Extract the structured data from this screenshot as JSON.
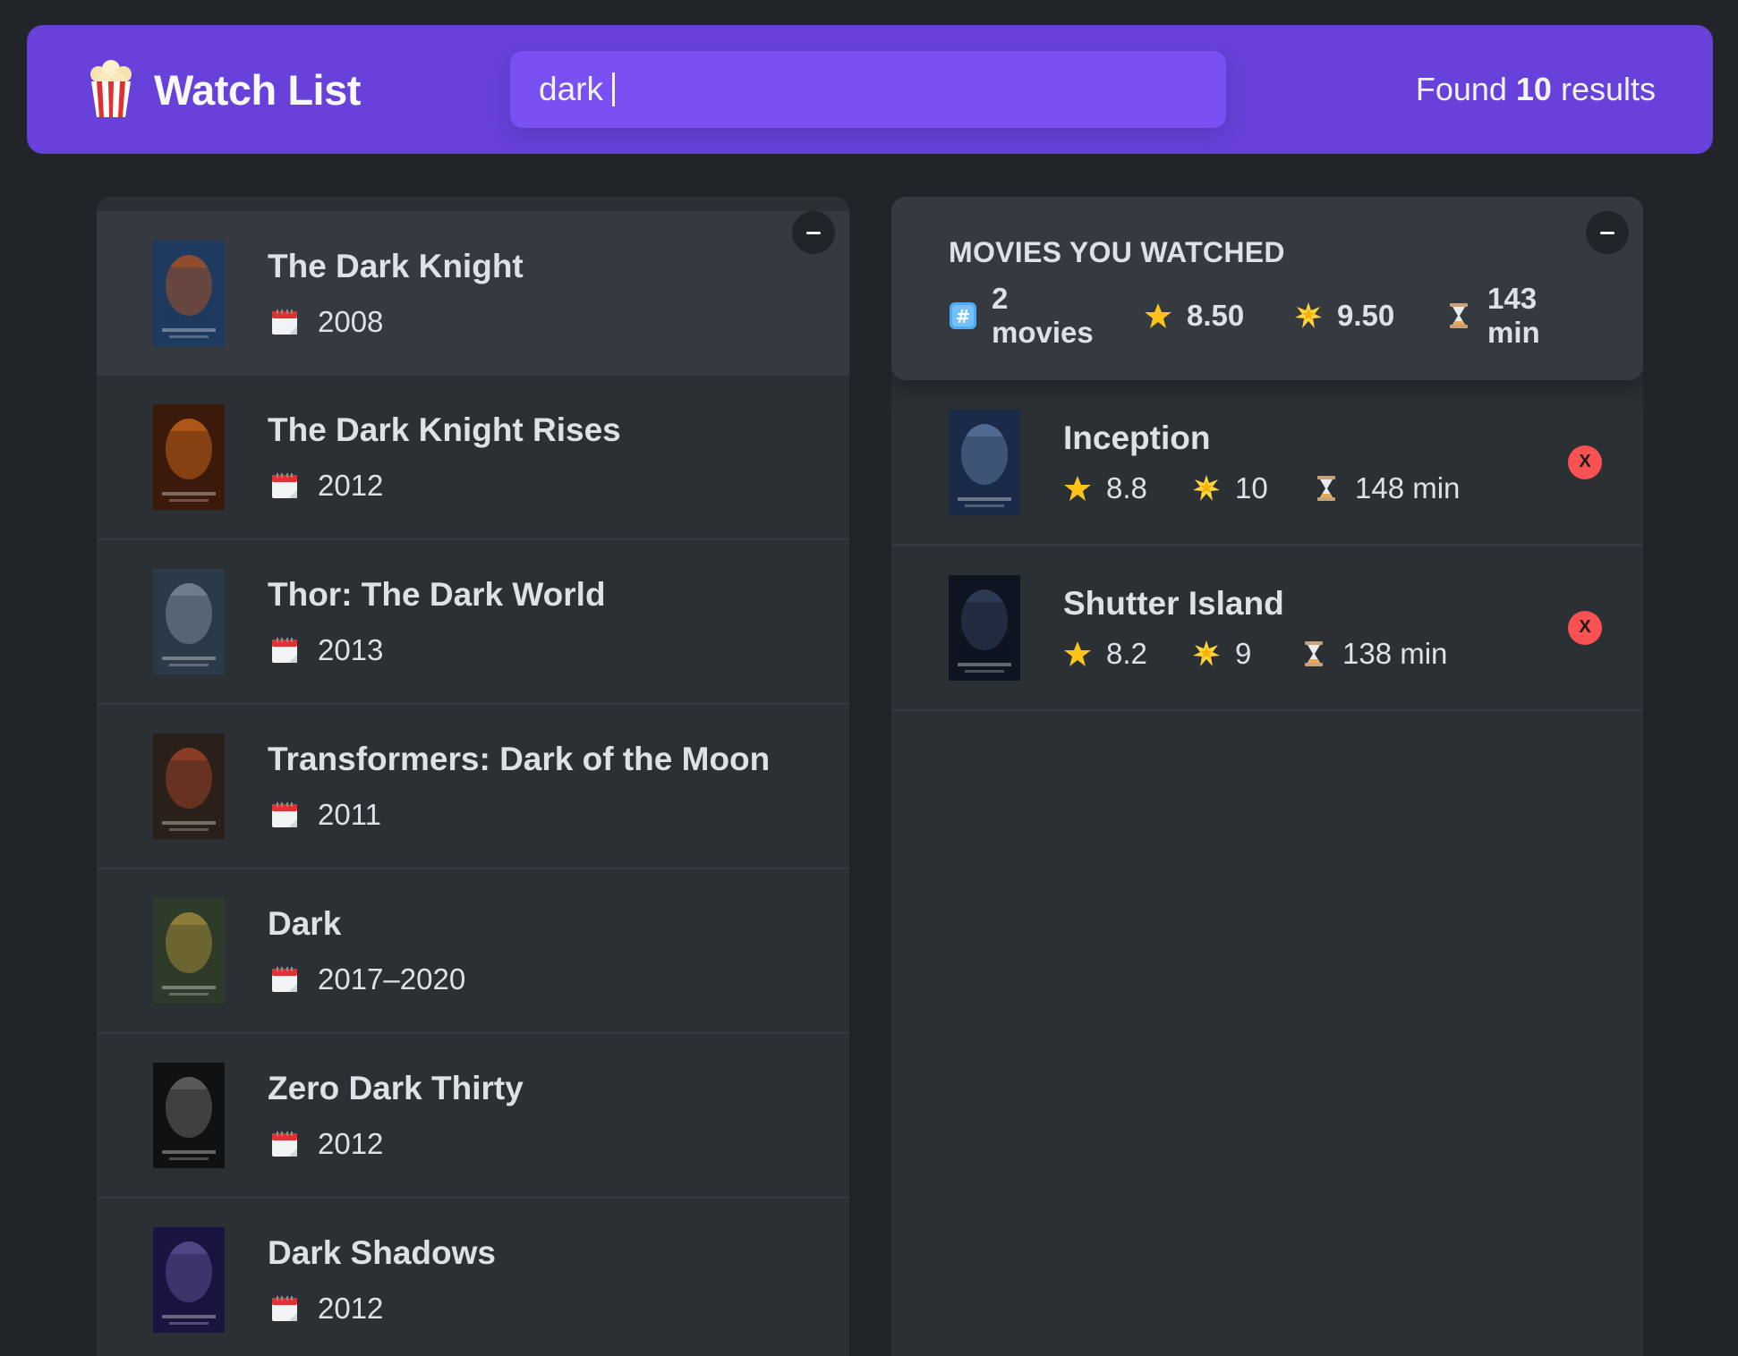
{
  "app": {
    "title": "Watch List",
    "logo_icon": "popcorn-icon"
  },
  "search": {
    "value": "dark"
  },
  "results": {
    "prefix": "Found ",
    "count": "10",
    "suffix": " results"
  },
  "left_list": {
    "toggle_label": "–",
    "items": [
      {
        "title": "The Dark Knight",
        "year": "2008",
        "poster_colors": [
          "#1e3a5f",
          "#c0561a"
        ]
      },
      {
        "title": "The Dark Knight Rises",
        "year": "2012",
        "poster_colors": [
          "#3b1a0c",
          "#e0701e"
        ]
      },
      {
        "title": "Thor: The Dark World",
        "year": "2013",
        "poster_colors": [
          "#2a3a48",
          "#8a9aa8"
        ]
      },
      {
        "title": "Transformers: Dark of the Moon",
        "year": "2011",
        "poster_colors": [
          "#2b1f1a",
          "#b04a2a"
        ]
      },
      {
        "title": "Dark",
        "year": "2017–2020",
        "poster_colors": [
          "#2e3a2a",
          "#b39a3a"
        ]
      },
      {
        "title": "Zero Dark Thirty",
        "year": "2012",
        "poster_colors": [
          "#111111",
          "#777777"
        ]
      },
      {
        "title": "Dark Shadows",
        "year": "2012",
        "poster_colors": [
          "#1a1440",
          "#6a5aa0"
        ]
      }
    ]
  },
  "summary": {
    "heading": "MOVIES YOU WATCHED",
    "movies_count": "2",
    "movies_word": "movies",
    "avg_imdb": "8.50",
    "avg_user": "9.50",
    "avg_runtime": "143",
    "runtime_unit": "min"
  },
  "watched": [
    {
      "title": "Inception",
      "imdb": "8.8",
      "user": "10",
      "runtime": "148 min",
      "delete_label": "X",
      "poster_colors": [
        "#1a2a48",
        "#6a86b0"
      ]
    },
    {
      "title": "Shutter Island",
      "imdb": "8.2",
      "user": "9",
      "runtime": "138 min",
      "delete_label": "X",
      "poster_colors": [
        "#0e1420",
        "#3a4a6a"
      ]
    }
  ],
  "colors": {
    "background": "#212529",
    "nav": "#6741d9",
    "search": "#7950f2",
    "panel": "#2b3035",
    "panel_light": "#343a40",
    "delete": "#fa5252"
  }
}
